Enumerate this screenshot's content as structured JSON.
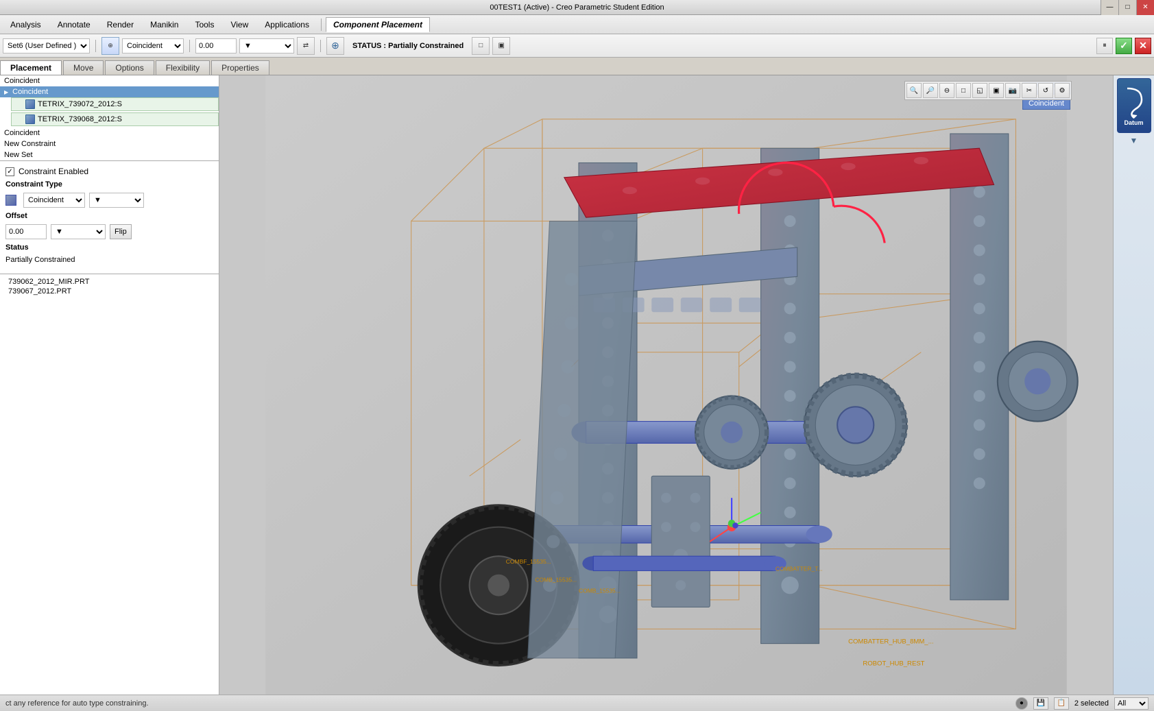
{
  "titlebar": {
    "title": "00TEST1 (Active) - Creo Parametric Student Edition",
    "min_btn": "—",
    "max_btn": "□",
    "close_btn": "✕"
  },
  "menubar": {
    "items": [
      "Analysis",
      "Annotate",
      "Render",
      "Manikin",
      "Tools",
      "View",
      "Applications"
    ],
    "active_tab": "Component Placement"
  },
  "toolbar": {
    "set_label": "Set6 (User Defined )",
    "user_defined": "User Defined",
    "constraint_type": "Coincident",
    "offset_value": "0.00",
    "status_label": "STATUS : Partially Constrained",
    "flip_label": "Flip",
    "status_value": "Partially Constrained",
    "pause_btn": "⏸",
    "ok_btn": "✓",
    "cancel_btn": "✕"
  },
  "tabs": {
    "items": [
      "Placement",
      "Move",
      "Options",
      "Flexibility",
      "Properties"
    ],
    "active": "Placement"
  },
  "constraint_panel": {
    "checkbox_label": "Constraint Enabled",
    "constraint_type_label": "Constraint Type",
    "offset_label": "Offset",
    "status_label": "Status",
    "status_value": "Partially Constrained",
    "constraints": [
      {
        "label": "Coincident",
        "type": "normal"
      },
      {
        "label": "Coincident",
        "type": "active"
      },
      {
        "label": "Coincident",
        "type": "normal"
      },
      {
        "label": "New Constraint",
        "type": "normal"
      },
      {
        "label": "New Set",
        "type": "normal"
      }
    ],
    "parts": [
      {
        "label": "TETRIX_739072_2012:S"
      },
      {
        "label": "TETRIX_739068_2012:S"
      }
    ],
    "sub_constraints": [
      {
        "label": "Coincident"
      },
      {
        "label": "New Constraint"
      },
      {
        "label": "New Set"
      }
    ]
  },
  "bottom_references": {
    "items": [
      "739062_2012_MIR.PRT",
      "739067_2012.PRT"
    ]
  },
  "viewport": {
    "coincident_tooltip1": "Coincident",
    "coincident_tooltip2": "Coincident",
    "toolbar_btns": [
      "🔍",
      "🔎",
      "⊕",
      "□",
      "◱",
      "◫",
      "📷",
      "✂",
      "↺",
      "⚙"
    ]
  },
  "right_panel": {
    "label": "Datum"
  },
  "statusbar": {
    "message": "ct any reference for auto type constraining.",
    "selected_count": "2 selected",
    "filter": "All"
  }
}
